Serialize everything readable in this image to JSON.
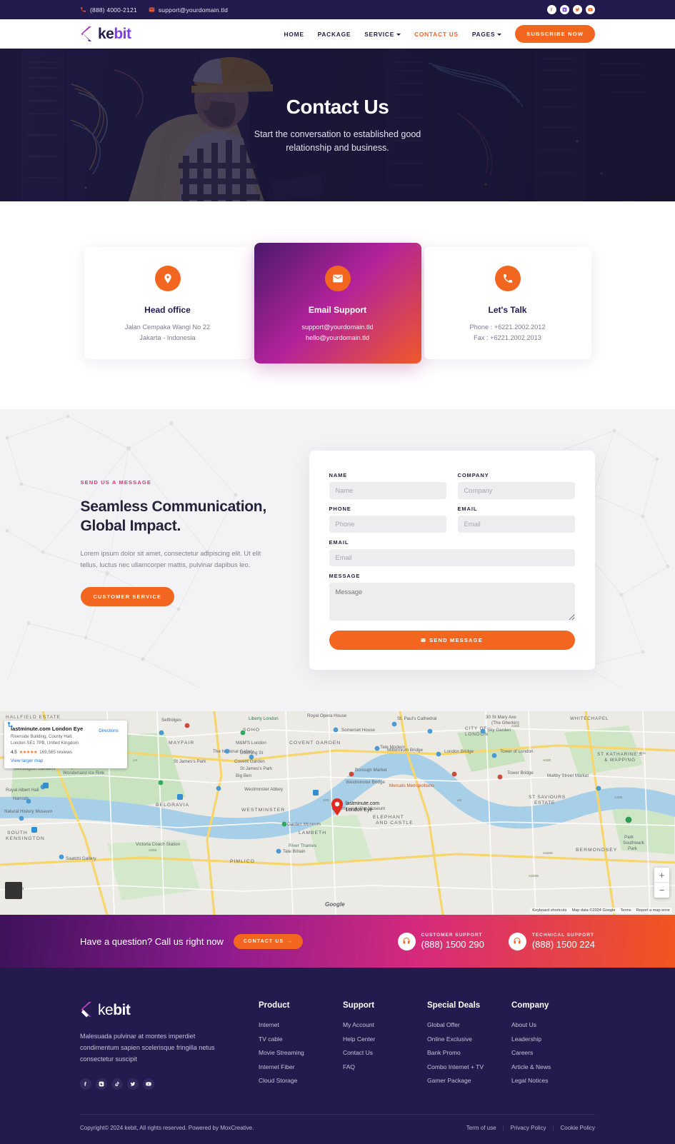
{
  "topbar": {
    "phone": "(888) 4000-2121",
    "email": "support@yourdomain.tld",
    "socials": [
      "facebook",
      "instagram",
      "twitter",
      "youtube"
    ]
  },
  "header": {
    "logo_ke": "ke",
    "logo_bit": "bit",
    "nav": [
      {
        "label": "HOME",
        "dropdown": false,
        "active": false
      },
      {
        "label": "PACKAGE",
        "dropdown": false,
        "active": false
      },
      {
        "label": "SERVICE",
        "dropdown": true,
        "active": false
      },
      {
        "label": "CONTACT US",
        "dropdown": false,
        "active": true
      },
      {
        "label": "PAGES",
        "dropdown": true,
        "active": false
      }
    ],
    "subscribe_label": "SUBSCRIBE NOW"
  },
  "hero": {
    "title": "Contact Us",
    "subtitle": "Start the conversation to established good relationship and business."
  },
  "cards": [
    {
      "icon": "location-pin-icon",
      "title": "Head office",
      "lines": [
        "Jalan Cempaka Wangi No 22",
        "Jakarta - Indonesia"
      ],
      "highlight": false
    },
    {
      "icon": "envelope-icon",
      "title": "Email Support",
      "lines": [
        "support@yourdomain.tld",
        "hello@yourdomain.tld"
      ],
      "highlight": true
    },
    {
      "icon": "phone-icon",
      "title": "Let's Talk",
      "lines": [
        "Phone : +6221.2002.2012",
        "Fax : +6221.2002.2013"
      ],
      "highlight": false
    }
  ],
  "form_section": {
    "eyebrow": "SEND US A MESSAGE",
    "title_line1": "Seamless Communication,",
    "title_line2": "Global Impact.",
    "description": "Lorem ipsum dolor sit amet, consectetur adipiscing elit. Ut elit tellus, luctus nec ullamcorper mattis, pulvinar dapibus leo.",
    "cta_label": "CUSTOMER SERVICE",
    "fields": {
      "name_label": "NAME",
      "name_placeholder": "Name",
      "company_label": "COMPANY",
      "company_placeholder": "Company",
      "phone_label": "PHONE",
      "phone_placeholder": "Phone",
      "email_label": "EMAIL",
      "email_placeholder": "Email",
      "email2_label": "EMAIL",
      "email2_placeholder": "Email",
      "message_label": "MESSAGE",
      "message_placeholder": "Message"
    },
    "submit_label": "SEND MESSAGE"
  },
  "map": {
    "place_name": "lastminute.com London Eye",
    "address_line1": "Riverside Building, County Hall,",
    "address_line2": "London SE1 7PB, United Kingdom",
    "rating": "4.5",
    "stars": "★★★★★",
    "reviews": "169,565 reviews",
    "view_larger": "View larger map",
    "directions_label": "Directions",
    "pin_label_line1": "lastminute.com",
    "pin_label_line2": "London Eye",
    "google_wordmark": "Google",
    "attribution": [
      "Keyboard shortcuts",
      "Map data ©2024 Google",
      "Terms",
      "Report a map error"
    ],
    "zoom_in": "+",
    "zoom_out": "−"
  },
  "cta_bar": {
    "question": "Have a question? Call us right now",
    "button_label": "CONTACT US",
    "button_arrow": "→",
    "supports": [
      {
        "label": "CUSTOMER SUPPORT",
        "number": "(888) 1500 290",
        "icon": "headset-icon"
      },
      {
        "label": "TECHNICAL SUPPORT",
        "number": "(888) 1500 224",
        "icon": "headset-icon"
      }
    ]
  },
  "footer": {
    "logo_ke": "ke",
    "logo_bit": "bit",
    "description": "Malesuada pulvinar at montes imperdiet condimentum sapien scelerisque fringilla netus consectetur suscipit",
    "socials": [
      "facebook",
      "instagram",
      "tiktok",
      "twitter",
      "youtube"
    ],
    "columns": [
      {
        "title": "Product",
        "links": [
          "Internet",
          "TV cable",
          "Movie Streaming",
          "Internet Fiber",
          "Cloud Storage"
        ]
      },
      {
        "title": "Support",
        "links": [
          "My Account",
          "Help Center",
          "Contact Us",
          "FAQ"
        ]
      },
      {
        "title": "Special Deals",
        "links": [
          "Global Offer",
          "Online Exclusive",
          "Bank Promo",
          "Combo Internet + TV",
          "Gamer Package"
        ]
      },
      {
        "title": "Company",
        "links": [
          "About Us",
          "Leadership",
          "Careers",
          "Article & News",
          "Legal Notices"
        ]
      }
    ],
    "copyright": "Copyright© 2024 kebit, All rights reserved. Powered by MoxCreative.",
    "legal": [
      "Term of use",
      "Privacy Policy",
      "Cookie Policy"
    ]
  },
  "colors": {
    "navy": "#231b4d",
    "orange": "#f2661f",
    "pink": "#e4307f",
    "purple": "#7b3fe4"
  }
}
